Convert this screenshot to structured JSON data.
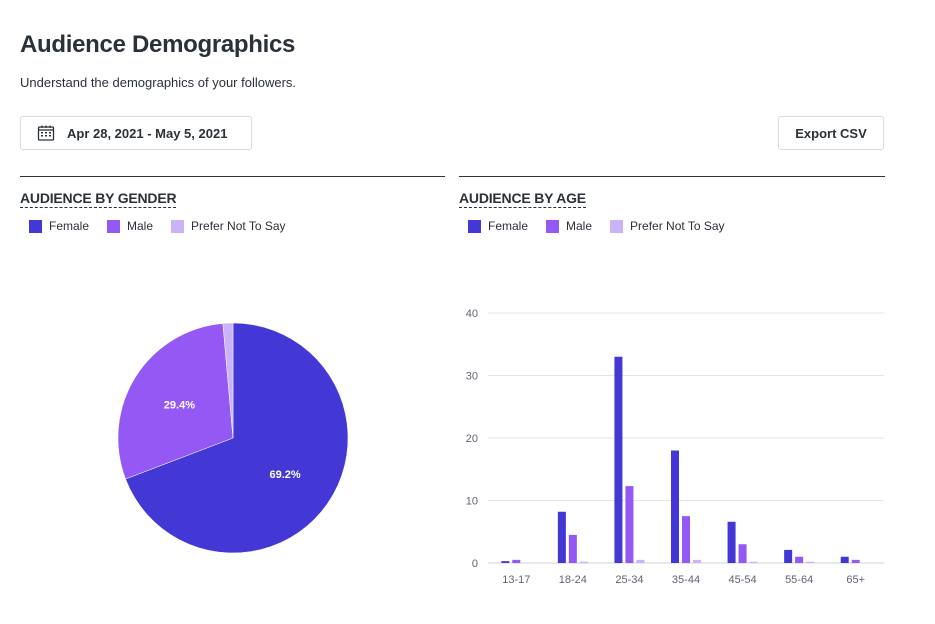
{
  "header": {
    "title": "Audience Demographics",
    "subtitle": "Understand the demographics of your followers."
  },
  "toolbar": {
    "date_range_label": "Apr 28, 2021 - May 5, 2021",
    "date_icon": "calendar-icon",
    "export_label": "Export CSV"
  },
  "colors": {
    "female": "#4338d6",
    "male": "#9458f5",
    "prefer_not_to_say": "#cbb3f7"
  },
  "chart_data": [
    {
      "type": "pie",
      "title": "AUDIENCE BY GENDER",
      "legend": [
        "Female",
        "Male",
        "Prefer Not To Say"
      ],
      "legend_placement": "top-left",
      "slices": [
        {
          "label": "Female",
          "value": 69.2,
          "display": "69.2%"
        },
        {
          "label": "Male",
          "value": 29.4,
          "display": "29.4%"
        },
        {
          "label": "Prefer Not To Say",
          "value": 1.4,
          "display": ""
        }
      ]
    },
    {
      "type": "bar",
      "title": "AUDIENCE BY AGE",
      "legend": [
        "Female",
        "Male",
        "Prefer Not To Say"
      ],
      "legend_placement": "top-left",
      "categories": [
        "13-17",
        "18-24",
        "25-34",
        "35-44",
        "45-54",
        "55-64",
        "65+"
      ],
      "series": [
        {
          "name": "Female",
          "values": [
            0.3,
            8.2,
            33.0,
            18.0,
            6.6,
            2.1,
            1.0
          ]
        },
        {
          "name": "Male",
          "values": [
            0.5,
            4.5,
            12.3,
            7.5,
            3.0,
            1.0,
            0.5
          ]
        },
        {
          "name": "Prefer Not To Say",
          "values": [
            0,
            0.2,
            0.5,
            0.5,
            0.2,
            0.2,
            0
          ]
        }
      ],
      "yticks": [
        0,
        10,
        20,
        30,
        40
      ],
      "ylim": [
        0,
        40
      ],
      "grid": true,
      "xlabel": "",
      "ylabel": ""
    }
  ]
}
